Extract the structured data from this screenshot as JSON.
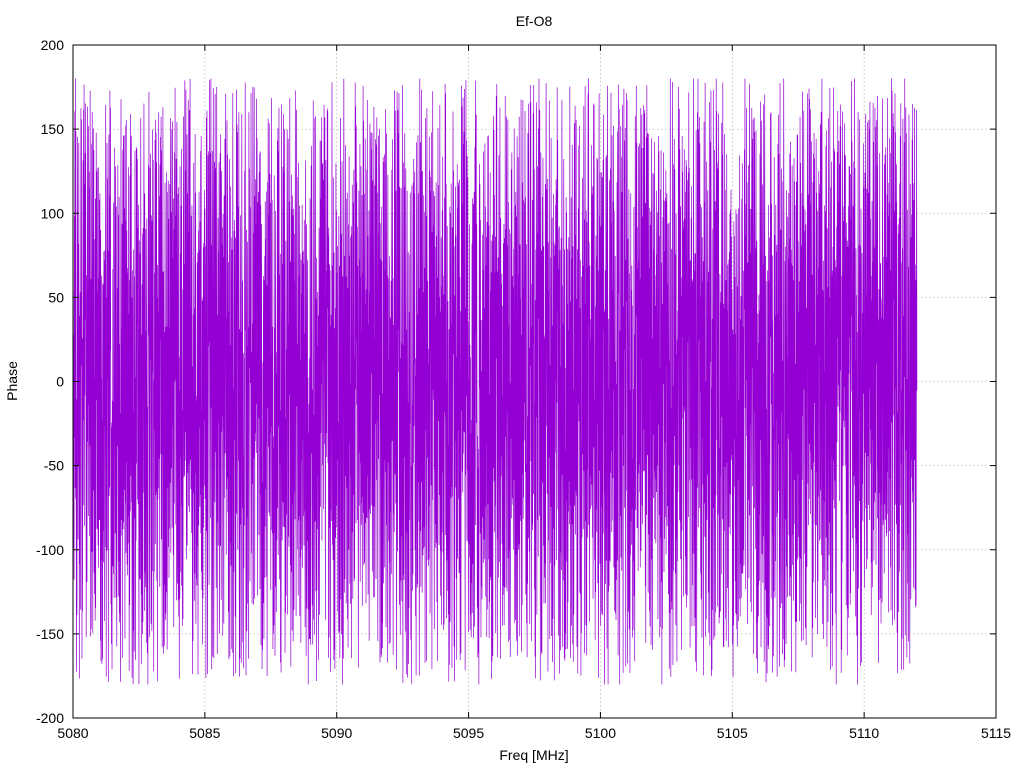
{
  "chart_data": {
    "type": "line",
    "title": "Ef-O8",
    "xlabel": "Freq [MHz]",
    "ylabel": "Phase",
    "xlim": [
      5080,
      5115
    ],
    "ylim": [
      -200,
      200
    ],
    "x_ticks": [
      5080,
      5085,
      5090,
      5095,
      5100,
      5105,
      5110,
      5115
    ],
    "y_ticks": [
      200,
      150,
      100,
      50,
      0,
      -50,
      -100,
      -150,
      -200
    ],
    "grid": true,
    "series_color": "#9400d3",
    "series": [
      {
        "data_range_x": [
          5080.0,
          5112.0
        ],
        "phase_wrap": [
          -180,
          180
        ],
        "sample_spacing_mhz": 0.01,
        "note_values": "phase wraps rapidly between approximately -180 and 180 across the whole frequency range"
      }
    ]
  }
}
